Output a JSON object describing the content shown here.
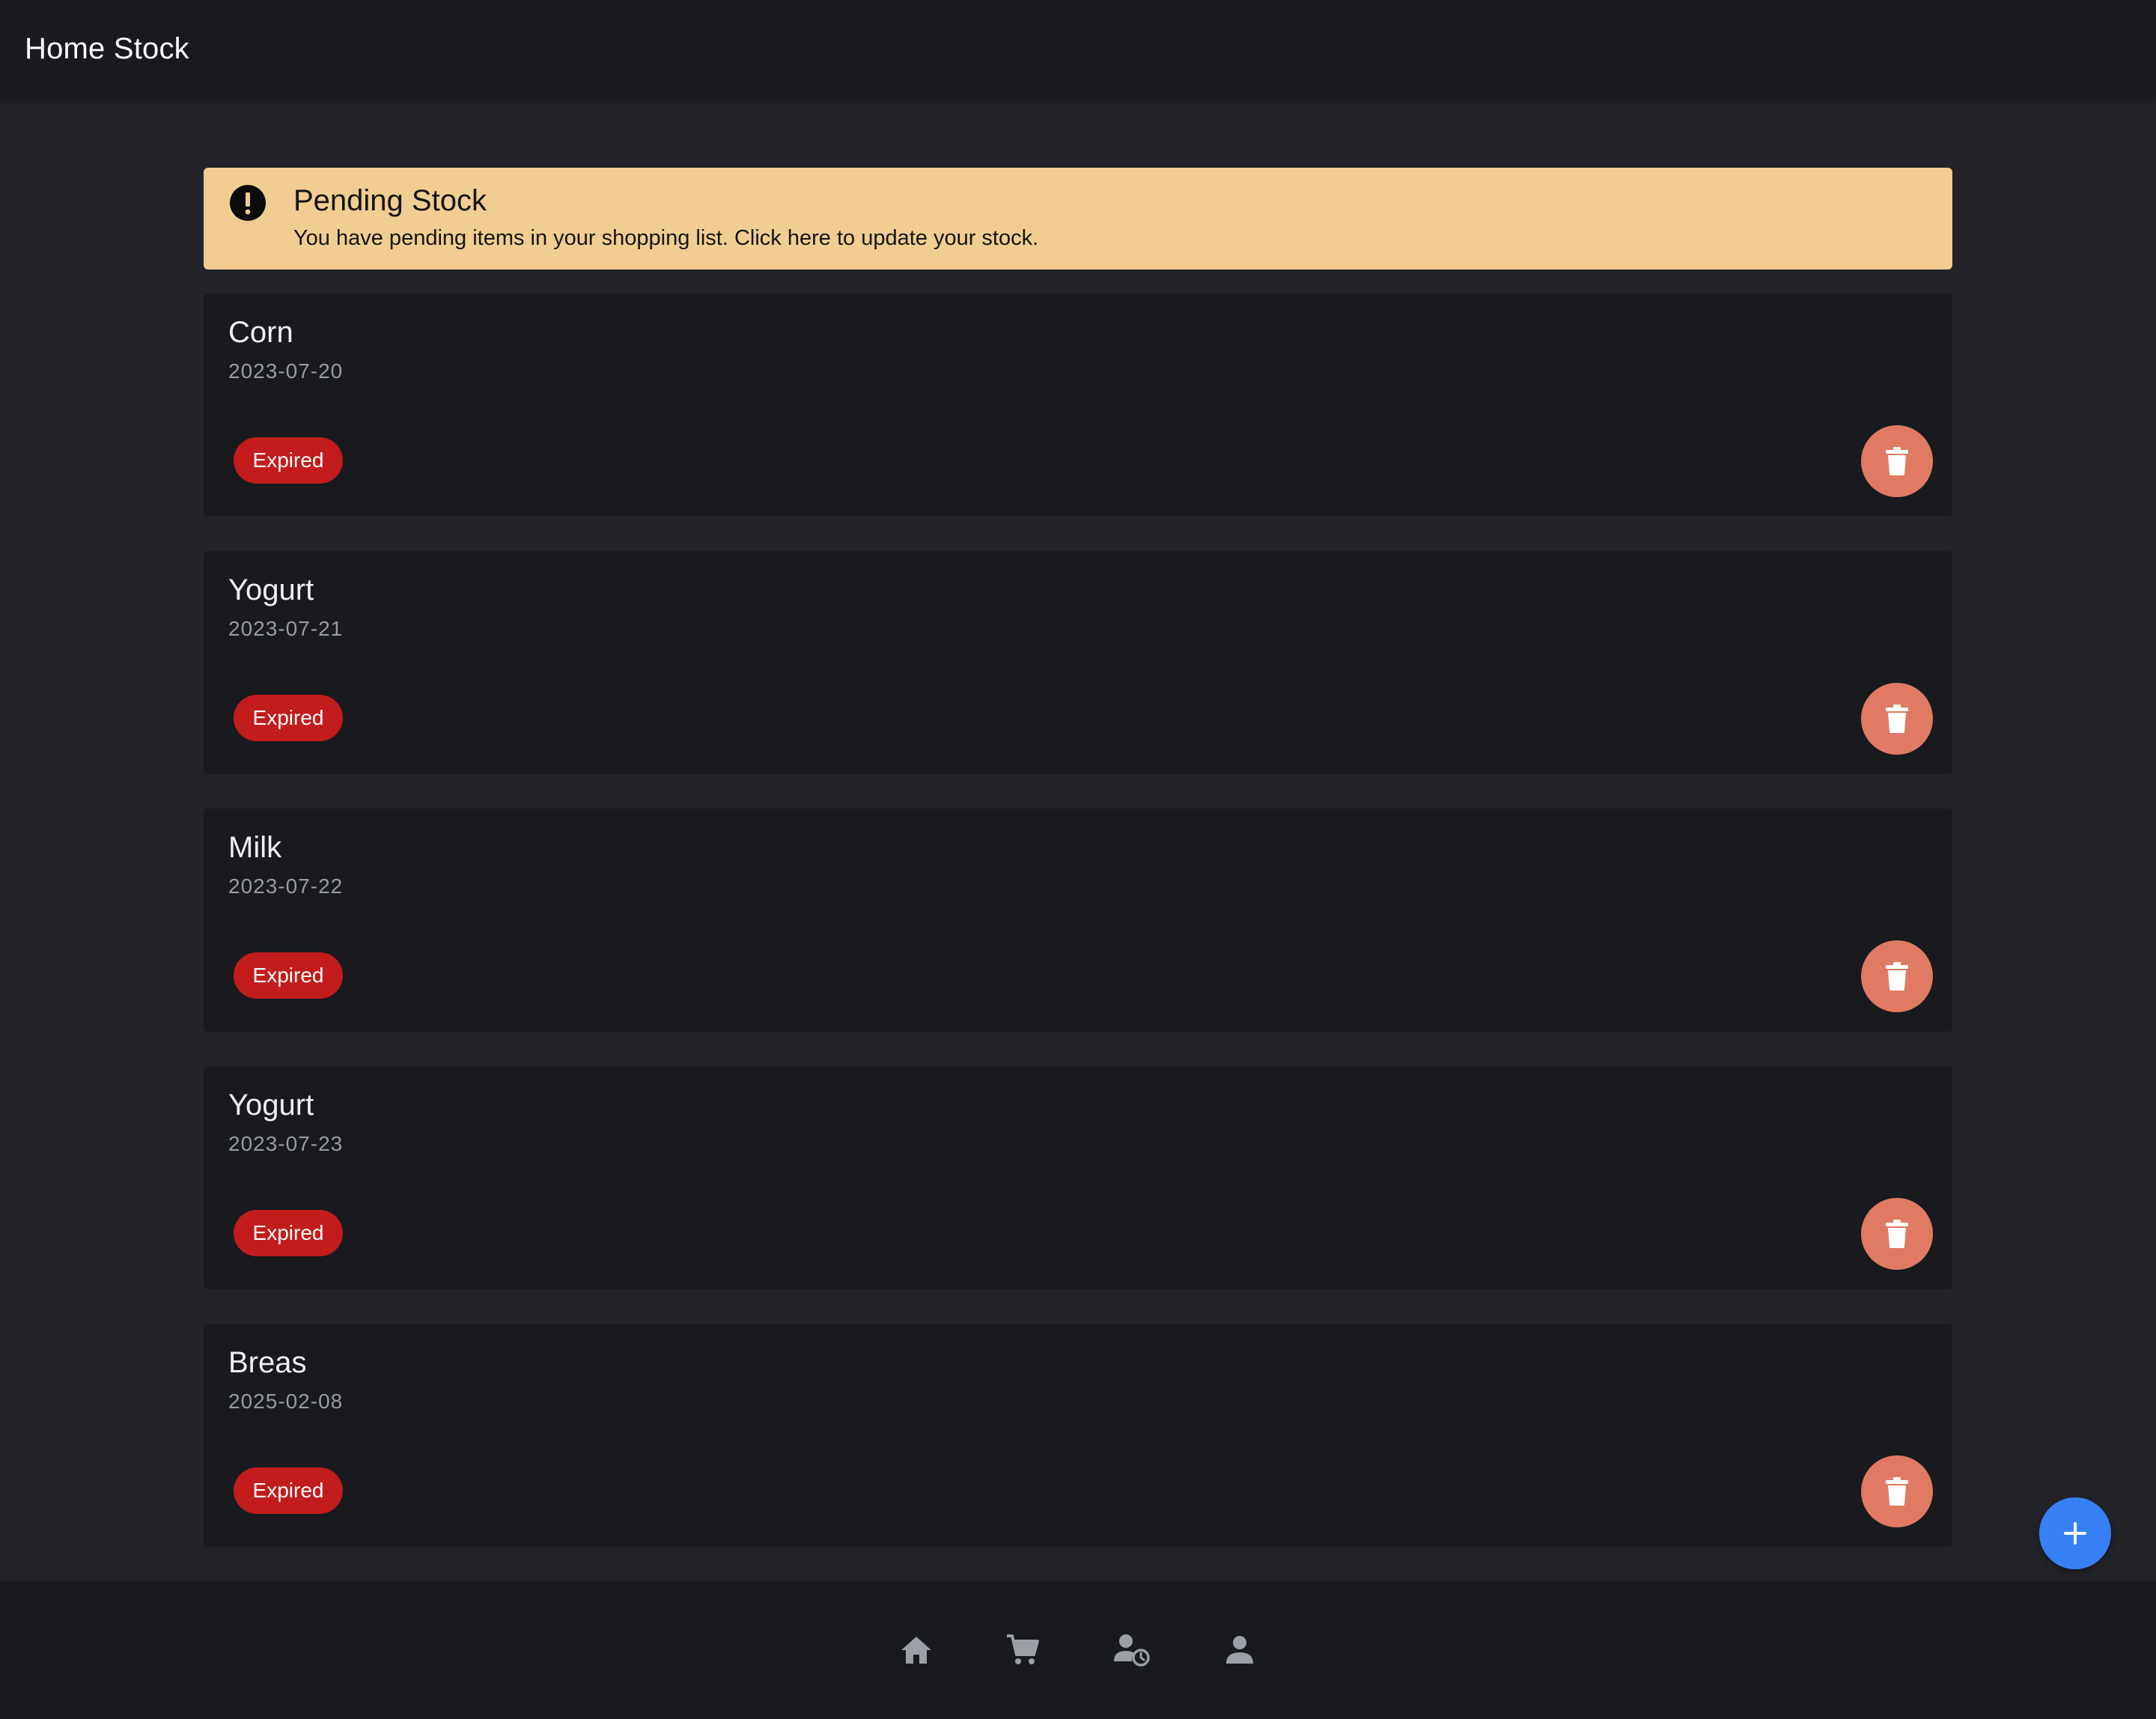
{
  "header": {
    "title": "Home Stock"
  },
  "alert": {
    "title": "Pending Stock",
    "message": "You have pending items in your shopping list. Click here to update your stock."
  },
  "stock_items": [
    {
      "name": "Corn",
      "date": "2023-07-20",
      "status": "Expired"
    },
    {
      "name": "Yogurt",
      "date": "2023-07-21",
      "status": "Expired"
    },
    {
      "name": "Milk",
      "date": "2023-07-22",
      "status": "Expired"
    },
    {
      "name": "Yogurt",
      "date": "2023-07-23",
      "status": "Expired"
    },
    {
      "name": "Breas",
      "date": "2025-02-08",
      "status": "Expired"
    }
  ],
  "icons": {
    "alert": "alert-circle-icon",
    "delete": "trash-icon",
    "add": "plus-icon",
    "nav": [
      "home-icon",
      "cart-icon",
      "user-clock-icon",
      "person-icon"
    ]
  },
  "colors": {
    "alert_bg": "#f2cd91",
    "badge_expired": "#c21c1c",
    "delete_button": "#e07a63",
    "fab": "#3880f7"
  }
}
